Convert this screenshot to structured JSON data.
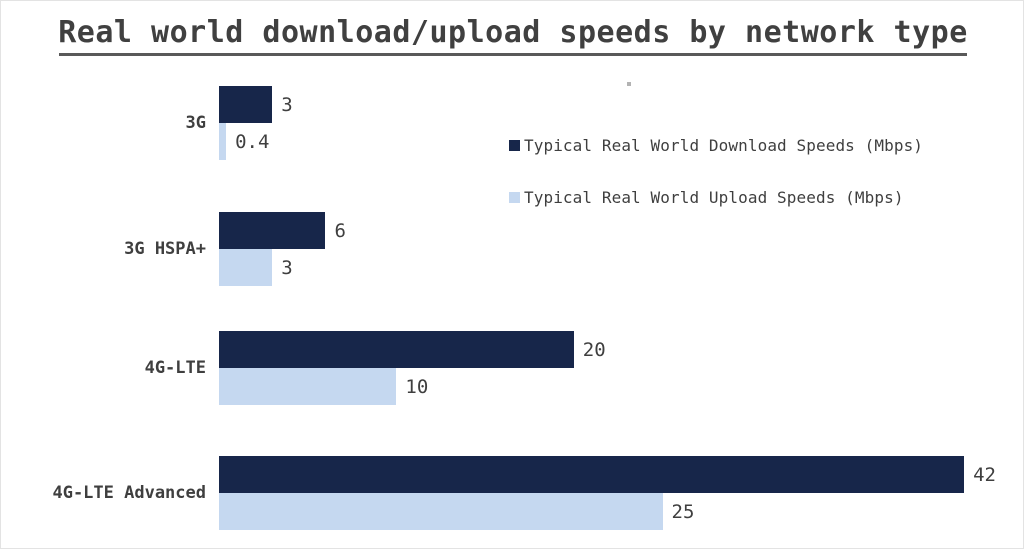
{
  "chart_data": {
    "type": "bar",
    "orientation": "horizontal",
    "grouping": "grouped",
    "title": "Real world download/upload speeds by network type",
    "xlabel": "",
    "ylabel": "",
    "categories": [
      "3G",
      "3G HSPA+",
      "4G-LTE",
      "4G-LTE Advanced"
    ],
    "series": [
      {
        "name": "Typical Real World Download Speeds  (Mbps)",
        "color": "#17264a",
        "values": [
          3,
          6,
          20,
          42
        ],
        "value_labels": [
          "3",
          "6",
          "20",
          "42"
        ]
      },
      {
        "name": "Typical Real World Upload Speeds  (Mbps)",
        "color": "#c5d8f0",
        "values": [
          0.4,
          3,
          10,
          25
        ],
        "value_labels": [
          "0.4",
          "3",
          "10",
          "25"
        ]
      }
    ],
    "xlim": [
      0,
      42
    ],
    "grid": false,
    "axis_visible": false,
    "legend_position": "center-right",
    "data_labels": true
  },
  "title": {
    "text": "Real world download/upload speeds by network type",
    "underline_color": "#595959"
  },
  "legend": {
    "items": [
      {
        "label": "Typical Real World Download Speeds  (Mbps)",
        "color": "#17264a",
        "swatch_icon": "square-swatch-icon"
      },
      {
        "label": "Typical Real World Upload Speeds  (Mbps)",
        "color": "#c5d8f0",
        "swatch_icon": "square-swatch-icon"
      }
    ]
  },
  "colors": {
    "download": "#17264a",
    "upload": "#c5d8f0",
    "text": "#3f3f3f",
    "rule": "#595959",
    "background": "#ffffff"
  }
}
